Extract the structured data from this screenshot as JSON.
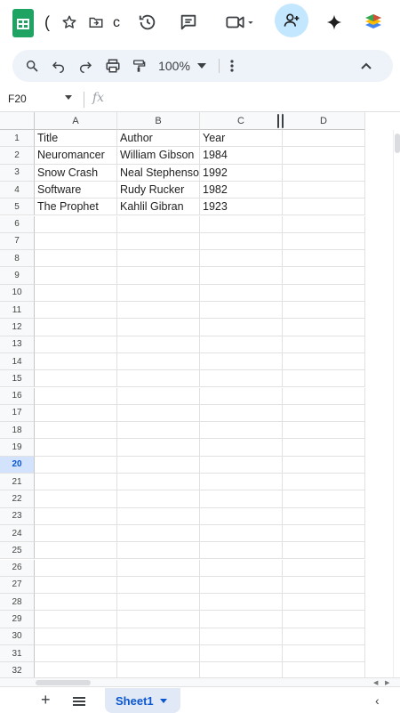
{
  "app": {
    "title_fragment": "(",
    "title_fragment2": "c"
  },
  "topbar": {
    "icons": [
      "star-icon",
      "move-to-folder-icon",
      "version-history-icon",
      "comments-icon",
      "meet-icon",
      "share-icon",
      "gemini-icon",
      "workspace-icon"
    ]
  },
  "toolbar": {
    "zoom": "100%"
  },
  "formula_bar": {
    "name_box": "F20",
    "fx_label": "fx",
    "formula": ""
  },
  "grid": {
    "columns": [
      "A",
      "B",
      "C",
      "D"
    ],
    "rows": [
      {
        "n": "1",
        "cells": [
          "Title",
          "Author",
          "Year",
          ""
        ]
      },
      {
        "n": "2",
        "cells": [
          "Neuromancer",
          "William Gibson",
          "1984",
          ""
        ]
      },
      {
        "n": "3",
        "cells": [
          "Snow Crash",
          "Neal Stephenson",
          "1992",
          ""
        ]
      },
      {
        "n": "4",
        "cells": [
          "Software",
          "Rudy Rucker",
          "1982",
          ""
        ]
      },
      {
        "n": "5",
        "cells": [
          "The Prophet",
          "Kahlil Gibran",
          "1923",
          ""
        ]
      },
      {
        "n": "6",
        "cells": [
          "",
          "",
          "",
          ""
        ]
      },
      {
        "n": "7",
        "cells": [
          "",
          "",
          "",
          ""
        ]
      },
      {
        "n": "8",
        "cells": [
          "",
          "",
          "",
          ""
        ]
      },
      {
        "n": "9",
        "cells": [
          "",
          "",
          "",
          ""
        ]
      },
      {
        "n": "10",
        "cells": [
          "",
          "",
          "",
          ""
        ]
      },
      {
        "n": "11",
        "cells": [
          "",
          "",
          "",
          ""
        ]
      },
      {
        "n": "12",
        "cells": [
          "",
          "",
          "",
          ""
        ]
      },
      {
        "n": "13",
        "cells": [
          "",
          "",
          "",
          ""
        ]
      },
      {
        "n": "14",
        "cells": [
          "",
          "",
          "",
          ""
        ]
      },
      {
        "n": "15",
        "cells": [
          "",
          "",
          "",
          ""
        ]
      },
      {
        "n": "16",
        "cells": [
          "",
          "",
          "",
          ""
        ]
      },
      {
        "n": "17",
        "cells": [
          "",
          "",
          "",
          ""
        ]
      },
      {
        "n": "18",
        "cells": [
          "",
          "",
          "",
          ""
        ]
      },
      {
        "n": "19",
        "cells": [
          "",
          "",
          "",
          ""
        ]
      },
      {
        "n": "20",
        "cells": [
          "",
          "",
          "",
          ""
        ]
      },
      {
        "n": "21",
        "cells": [
          "",
          "",
          "",
          ""
        ]
      },
      {
        "n": "22",
        "cells": [
          "",
          "",
          "",
          ""
        ]
      },
      {
        "n": "23",
        "cells": [
          "",
          "",
          "",
          ""
        ]
      },
      {
        "n": "24",
        "cells": [
          "",
          "",
          "",
          ""
        ]
      },
      {
        "n": "25",
        "cells": [
          "",
          "",
          "",
          ""
        ]
      },
      {
        "n": "26",
        "cells": [
          "",
          "",
          "",
          ""
        ]
      },
      {
        "n": "27",
        "cells": [
          "",
          "",
          "",
          ""
        ]
      },
      {
        "n": "28",
        "cells": [
          "",
          "",
          "",
          ""
        ]
      },
      {
        "n": "29",
        "cells": [
          "",
          "",
          "",
          ""
        ]
      },
      {
        "n": "30",
        "cells": [
          "",
          "",
          "",
          ""
        ]
      },
      {
        "n": "31",
        "cells": [
          "",
          "",
          "",
          ""
        ]
      },
      {
        "n": "32",
        "cells": [
          "",
          "",
          "",
          ""
        ]
      }
    ],
    "selected_row": "20"
  },
  "tabs": {
    "sheets": [
      {
        "label": "Sheet1",
        "active": true
      }
    ]
  },
  "colors": {
    "brand_green": "#1ea362",
    "accent_blue": "#0b57d0",
    "share_bg": "#c2e7ff",
    "toolbar_bg": "#eef2f9"
  }
}
